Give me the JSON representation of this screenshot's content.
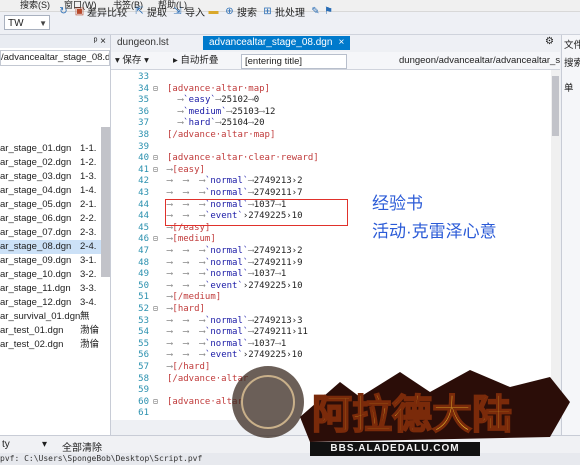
{
  "menu": [
    "搜索(S)",
    "窗口(W)",
    "书签(B)",
    "帮助(L)"
  ],
  "toolbar": {
    "combo": "TW",
    "items": [
      "差异比较",
      "提取",
      "导入",
      "搜索",
      "批处理"
    ]
  },
  "left_panel": {
    "pin": "ᵖ ×",
    "path": "/advancealtar_stage_08.dg",
    "files": [
      {
        "name": "ar_stage_01.dgn",
        "note": "1-1."
      },
      {
        "name": "ar_stage_02.dgn",
        "note": "1-2."
      },
      {
        "name": "ar_stage_03.dgn",
        "note": "1-3."
      },
      {
        "name": "ar_stage_04.dgn",
        "note": "1-4."
      },
      {
        "name": "ar_stage_05.dgn",
        "note": "2-1."
      },
      {
        "name": "ar_stage_06.dgn",
        "note": "2-2."
      },
      {
        "name": "ar_stage_07.dgn",
        "note": "2-3."
      },
      {
        "name": "ar_stage_08.dgn",
        "note": "2-4."
      },
      {
        "name": "ar_stage_09.dgn",
        "note": "3-1."
      },
      {
        "name": "ar_stage_10.dgn",
        "note": "3-2."
      },
      {
        "name": "ar_stage_11.dgn",
        "note": "3-3."
      },
      {
        "name": "ar_stage_12.dgn",
        "note": "3-4."
      },
      {
        "name": "ar_survival_01.dgn",
        "note": "無"
      },
      {
        "name": "ar_test_01.dgn",
        "note": "渤倫"
      },
      {
        "name": "ar_test_02.dgn",
        "note": "渤倫"
      }
    ]
  },
  "tabs": [
    "dungeon.lst",
    "advancealtar_stage_08.dgn"
  ],
  "editor_bar": {
    "save": "保存",
    "fold": "自动折叠",
    "section": "[entering title]",
    "path": "dungeon/advancealtar/advancealtar_s"
  },
  "code_lines": [
    {
      "n": "33",
      "f": "",
      "t": ""
    },
    {
      "n": "34",
      "f": "⊟",
      "t": "[advance·altar·map]"
    },
    {
      "n": "35",
      "f": "",
      "t": "  ⟶`easy`⟶25102⟶0"
    },
    {
      "n": "36",
      "f": "",
      "t": "  ⟶`medium`⟶25103⟶12"
    },
    {
      "n": "37",
      "f": "",
      "t": "  ⟶`hard`⟶25104⟶20"
    },
    {
      "n": "38",
      "f": "",
      "t": "[/advance·altar·map]"
    },
    {
      "n": "39",
      "f": "",
      "t": ""
    },
    {
      "n": "40",
      "f": "⊟",
      "t": "[advance·altar·clear·reward]"
    },
    {
      "n": "41",
      "f": "⊟",
      "t": "⟶[easy]"
    },
    {
      "n": "42",
      "f": "",
      "t": "⟶  ⟶  ⟶`normal`⟶2749213›2"
    },
    {
      "n": "43",
      "f": "",
      "t": "⟶  ⟶  ⟶`normal`⟶2749211›7"
    },
    {
      "n": "44",
      "f": "",
      "t": "⟶  ⟶  ⟶`normal`⟶1037⟶1"
    },
    {
      "n": "44",
      "f": "",
      "t": "⟶  ⟶  ⟶`event`›2749225›10"
    },
    {
      "n": "45",
      "f": "",
      "t": "⟶[/easy]"
    },
    {
      "n": "46",
      "f": "⊟",
      "t": "⟶[medium]"
    },
    {
      "n": "47",
      "f": "",
      "t": "⟶  ⟶  ⟶`normal`⟶2749213›2"
    },
    {
      "n": "48",
      "f": "",
      "t": "⟶  ⟶  ⟶`normal`⟶2749211›9"
    },
    {
      "n": "49",
      "f": "",
      "t": "⟶  ⟶  ⟶`normal`⟶1037⟶1"
    },
    {
      "n": "50",
      "f": "",
      "t": "⟶  ⟶  ⟶`event`›2749225›10"
    },
    {
      "n": "51",
      "f": "",
      "t": "⟶[/medium]"
    },
    {
      "n": "52",
      "f": "⊟",
      "t": "⟶[hard]"
    },
    {
      "n": "53",
      "f": "",
      "t": "⟶  ⟶  ⟶`normal`⟶2749213›3"
    },
    {
      "n": "54",
      "f": "",
      "t": "⟶  ⟶  ⟶`normal`⟶2749211›11"
    },
    {
      "n": "55",
      "f": "",
      "t": "⟶  ⟶  ⟶`normal`⟶1037⟶1"
    },
    {
      "n": "56",
      "f": "",
      "t": "⟶  ⟶  ⟶`event`›2749225›10"
    },
    {
      "n": "57",
      "f": "",
      "t": "⟶[/hard]"
    },
    {
      "n": "58",
      "f": "",
      "t": "[/advance·altar"
    },
    {
      "n": "59",
      "f": "",
      "t": ""
    },
    {
      "n": "60",
      "f": "⊟",
      "t": "[advance·altar"
    },
    {
      "n": "61",
      "f": "",
      "t": ""
    }
  ],
  "annotations": {
    "line1": "经验书",
    "line2": "活动·克雷泽心意"
  },
  "right_panel": {
    "title": "文件",
    "sub": "搜索",
    "label": "单"
  },
  "bottom": {
    "type": "ty",
    "clear": "全部清除"
  },
  "status": "pvf: C:\\Users\\SpongeBob\\Desktop\\Script.pvf",
  "watermark": {
    "title": "阿拉德大陆",
    "url": "BBS.ALADEDALU.COM"
  },
  "colors": {
    "accent": "#007acc",
    "tag": "#c03b3b",
    "annotation": "#2b5bd7",
    "highlight": "#e0312b"
  }
}
